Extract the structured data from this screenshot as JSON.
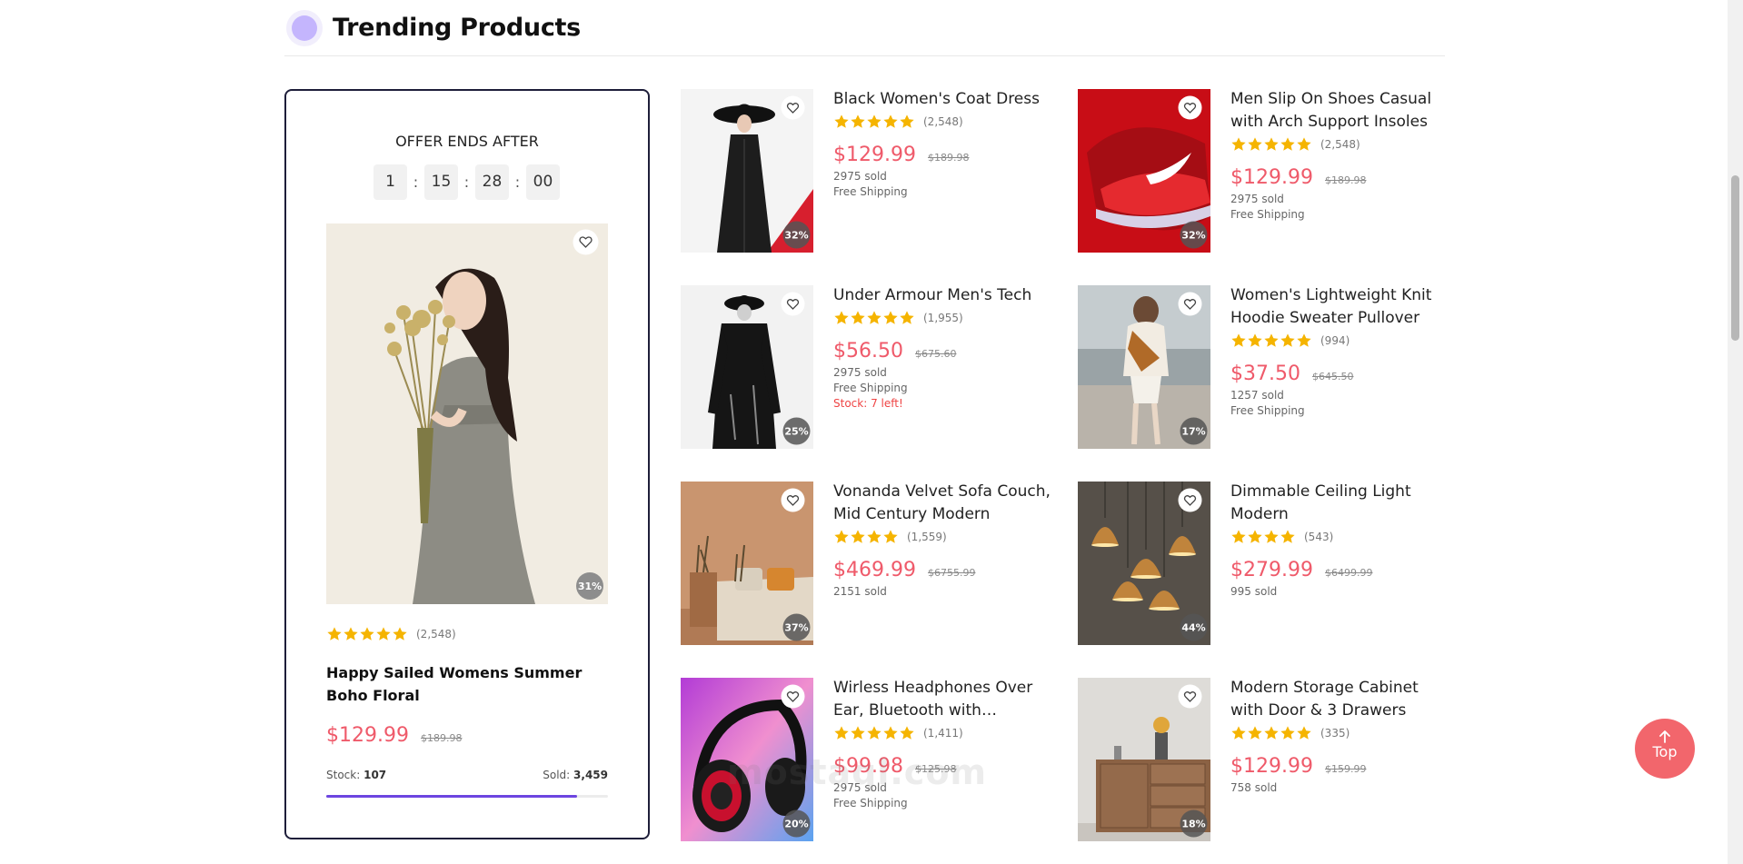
{
  "header": {
    "title": "Trending Products"
  },
  "deal": {
    "offer_label": "OFFER ENDS AFTER",
    "countdown": {
      "days": "1",
      "hours": "15",
      "minutes": "28",
      "seconds": "00"
    },
    "discount": "31%",
    "rating": 5,
    "reviews": "(2,548)",
    "name": "Happy Sailed Womens Summer Boho Floral",
    "price": "$129.99",
    "old_price": "$189.98",
    "stock_label": "Stock:",
    "stock_value": "107",
    "sold_label": "Sold:",
    "sold_value": "3,459",
    "sold_fraction": 0.89
  },
  "products": [
    {
      "name": "Black Women's Coat Dress",
      "rating": 5,
      "reviews": "(2,548)",
      "price": "$129.99",
      "old_price": "$189.98",
      "sold": "2975 sold",
      "shipping": "Free Shipping",
      "stock": "",
      "discount": "32%"
    },
    {
      "name": "Men Slip On Shoes Casual with Arch Support Insoles",
      "rating": 5,
      "reviews": "(2,548)",
      "price": "$129.99",
      "old_price": "$189.98",
      "sold": "2975 sold",
      "shipping": "Free Shipping",
      "stock": "",
      "discount": "32%"
    },
    {
      "name": "Under Armour Men's Tech",
      "rating": 5,
      "reviews": "(1,955)",
      "price": "$56.50",
      "old_price": "$675.60",
      "sold": "2975 sold",
      "shipping": "Free Shipping",
      "stock": "Stock: 7 left!",
      "discount": "25%"
    },
    {
      "name": "Women's Lightweight Knit Hoodie Sweater Pullover",
      "rating": 5,
      "reviews": "(994)",
      "price": "$37.50",
      "old_price": "$645.50",
      "sold": "1257 sold",
      "shipping": "Free Shipping",
      "stock": "",
      "discount": "17%"
    },
    {
      "name": "Vonanda Velvet Sofa Couch, Mid Century Modern",
      "rating": 4,
      "reviews": "(1,559)",
      "price": "$469.99",
      "old_price": "$6755.99",
      "sold": "2151 sold",
      "shipping": "",
      "stock": "",
      "discount": "37%"
    },
    {
      "name": "Dimmable Ceiling Light Modern",
      "rating": 4,
      "reviews": "(543)",
      "price": "$279.99",
      "old_price": "$6499.99",
      "sold": "995 sold",
      "shipping": "",
      "stock": "",
      "discount": "44%"
    },
    {
      "name": "Wirless Headphones Over Ear, Bluetooth with Microphone",
      "rating": 5,
      "reviews": "(1,411)",
      "price": "$99.98",
      "old_price": "$125.98",
      "sold": "2975 sold",
      "shipping": "Free Shipping",
      "stock": "",
      "discount": "20%"
    },
    {
      "name": "Modern Storage Cabinet with Door & 3 Drawers",
      "rating": 5,
      "reviews": "(335)",
      "price": "$129.99",
      "old_price": "$159.99",
      "sold": "758 sold",
      "shipping": "",
      "stock": "",
      "discount": "18%"
    }
  ],
  "top_button": {
    "label": "Top"
  },
  "watermark": "mostaql.com",
  "colors": {
    "accent": "#6d45e0",
    "price": "#ef5a6a",
    "star": "#f5b400",
    "top_button": "#f2666c",
    "border": "#1e1e3a"
  }
}
